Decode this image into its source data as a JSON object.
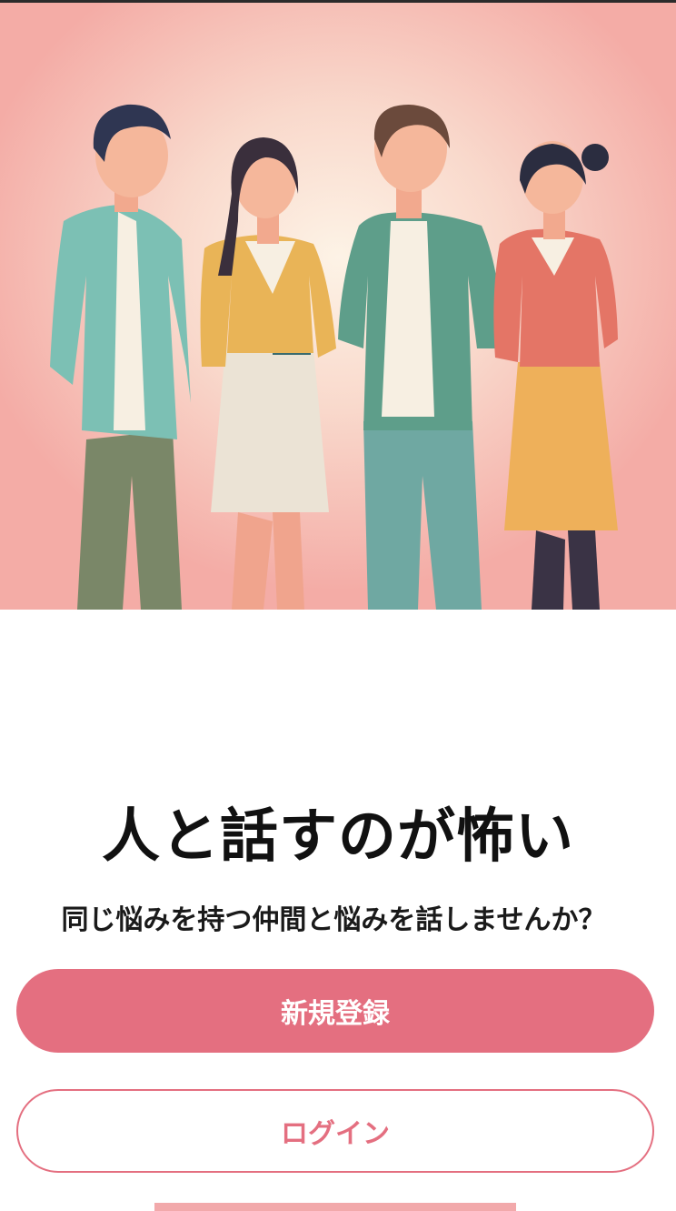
{
  "hero": {
    "illustration": "four-friends-talking-illustration",
    "background_color": "#f4aca6"
  },
  "main": {
    "title": "人と話すのが怖い",
    "subtitle": "同じ悩みを持つ仲間と悩みを話しませんか？"
  },
  "actions": {
    "register_label": "新規登録",
    "login_label": "ログイン",
    "accent_color": "#e46f80"
  }
}
